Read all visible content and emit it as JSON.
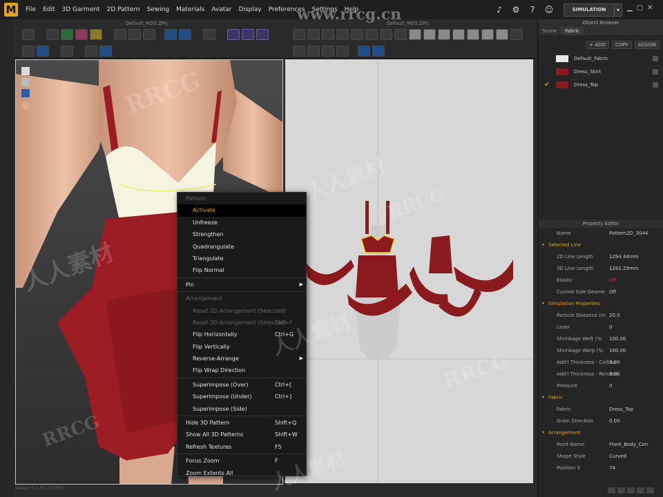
{
  "app": {
    "logo": "M"
  },
  "menu": [
    "File",
    "Edit",
    "3D Garment",
    "2D Pattern",
    "Sewing",
    "Materials",
    "Avatar",
    "Display",
    "Preferences",
    "Settings",
    "Help"
  ],
  "menu_icons": [
    "volume-icon",
    "gear-icon",
    "help-icon",
    "user-icon"
  ],
  "simulation_label": "SIMULATION",
  "toolbar": {
    "title_3d": "Default_MD5.ZPrj",
    "title_2d": "Default_MD5.ZPrj"
  },
  "object_browser": {
    "title": "Object Browser",
    "tabs": [
      "Scene",
      "Fabric"
    ],
    "buttons": [
      "+ ADD",
      "COPY",
      "ASSIGN"
    ],
    "fabrics": [
      {
        "name": "Default_Fabric",
        "color": "#e8e8e8",
        "checked": false
      },
      {
        "name": "Dress_Skirt",
        "color": "#8b1a1e",
        "checked": false
      },
      {
        "name": "Dress_Top",
        "color": "#8b1a1e",
        "checked": true
      }
    ]
  },
  "property_editor": {
    "title": "Property Editor",
    "rows": [
      {
        "type": "plain",
        "key": "Name",
        "value": "Pattern2D_3044"
      },
      {
        "type": "sec",
        "key": "Selected Line"
      },
      {
        "type": "plain",
        "key": "2D Line Length",
        "value": "1294.44mm"
      },
      {
        "type": "plain",
        "key": "3D Line Length",
        "value": "1282.29mm"
      },
      {
        "type": "plain",
        "key": "Elastic",
        "value": "Off",
        "red": true
      },
      {
        "type": "plain",
        "key": "Curved Side Geome",
        "value": "Off"
      },
      {
        "type": "sec",
        "key": "Simulation Properties"
      },
      {
        "type": "plain",
        "key": "Particle Distance (m",
        "value": "20.0"
      },
      {
        "type": "plain",
        "key": "Layer",
        "value": "0"
      },
      {
        "type": "plain",
        "key": "Shrinkage Weft (%",
        "value": "100.00"
      },
      {
        "type": "plain",
        "key": "Shrinkage Warp (%",
        "value": "100.00"
      },
      {
        "type": "plain",
        "key": "Add'l Thickness - Collisio",
        "value": "3.00"
      },
      {
        "type": "plain",
        "key": "Add'l Thickness - Renderi",
        "value": "3.00"
      },
      {
        "type": "plain",
        "key": "Pressure",
        "value": "0"
      },
      {
        "type": "sec",
        "key": "Fabric"
      },
      {
        "type": "plain",
        "key": "Fabric",
        "value": "Dress_Top"
      },
      {
        "type": "plain",
        "key": "Grain Direction",
        "value": "0.00"
      },
      {
        "type": "sec",
        "key": "Arrangement"
      },
      {
        "type": "plain",
        "key": "Point Name",
        "value": "Front_Body_Cen"
      },
      {
        "type": "plain",
        "key": "Shape Style",
        "value": "Curved"
      },
      {
        "type": "plain",
        "key": "Position X",
        "value": "74"
      }
    ]
  },
  "context_menu": {
    "items": [
      {
        "kind": "head",
        "label": "Pattern"
      },
      {
        "kind": "item",
        "label": "Activate",
        "hl": true
      },
      {
        "kind": "item",
        "label": "Unfreeze"
      },
      {
        "kind": "item",
        "label": "Strengthen"
      },
      {
        "kind": "item",
        "label": "Quadrangulate"
      },
      {
        "kind": "item",
        "label": "Triangulate"
      },
      {
        "kind": "item",
        "label": "Flip Normal"
      },
      {
        "kind": "sep"
      },
      {
        "kind": "top",
        "label": "Pin",
        "sub": true
      },
      {
        "kind": "sep"
      },
      {
        "kind": "head",
        "label": "Arrangement"
      },
      {
        "kind": "item",
        "label": "Reset 2D Arrangement (Selected)",
        "dis": true
      },
      {
        "kind": "item",
        "label": "Reset 3D Arrangement (Selected)",
        "shortcut": "Ctrl+F",
        "dis": true
      },
      {
        "kind": "item",
        "label": "Flip Horizontally",
        "shortcut": "Ctrl+G"
      },
      {
        "kind": "item",
        "label": "Flip Vertically"
      },
      {
        "kind": "item",
        "label": "Reverse-Arrange",
        "sub": true
      },
      {
        "kind": "item",
        "label": "Flip Wrap Direction"
      },
      {
        "kind": "sep"
      },
      {
        "kind": "item",
        "label": "Superimpose (Over)",
        "shortcut": "Ctrl+["
      },
      {
        "kind": "item",
        "label": "Superimpose (Under)",
        "shortcut": "Ctrl+]"
      },
      {
        "kind": "item",
        "label": "Superimpose (Side)"
      },
      {
        "kind": "sep"
      },
      {
        "kind": "top",
        "label": "Hide 3D Pattern",
        "shortcut": "Shift+Q"
      },
      {
        "kind": "top",
        "label": "Show All 3D Patterns",
        "shortcut": "Shift+W"
      },
      {
        "kind": "top",
        "label": "Refresh Textures",
        "shortcut": "F5"
      },
      {
        "kind": "sep"
      },
      {
        "kind": "top",
        "label": "Focus Zoom",
        "shortcut": "F"
      },
      {
        "kind": "top",
        "label": "Zoom Extents All"
      }
    ]
  },
  "status": {
    "version": "Version 5.1.00 (r16785)"
  },
  "watermarks": [
    "www.rrcg.cn",
    "RRCG",
    "人人素材",
    "RRCG",
    "人人素材",
    "RRCG",
    "人人素材",
    "RRCG",
    "人人素材"
  ]
}
